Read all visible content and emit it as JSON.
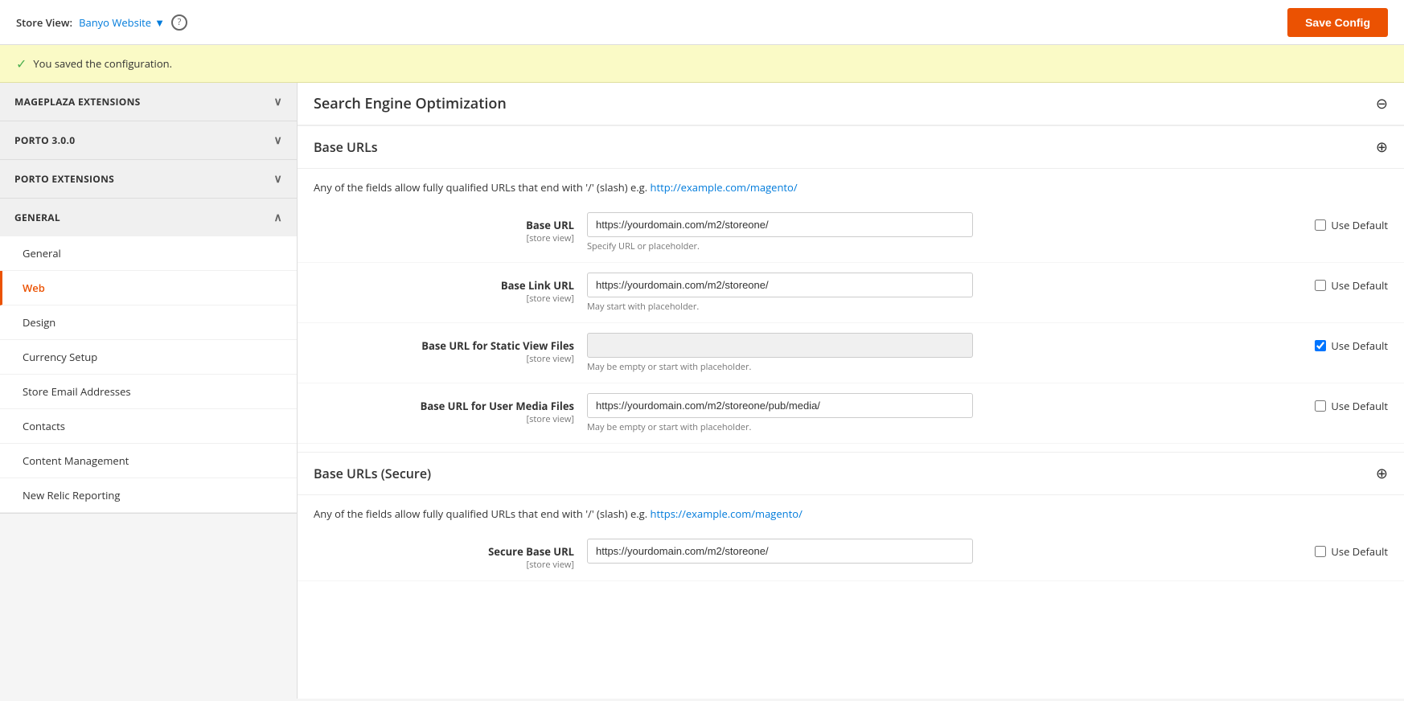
{
  "header": {
    "store_view_label": "Store View:",
    "store_view_name": "Banyo Website",
    "save_button_label": "Save Config"
  },
  "success_message": "You saved the configuration.",
  "sidebar": {
    "sections": [
      {
        "id": "mageplaza-extensions",
        "label": "MAGEPLAZA EXTENSIONS",
        "expanded": false,
        "items": []
      },
      {
        "id": "porto-300",
        "label": "PORTO 3.0.0",
        "expanded": false,
        "items": []
      },
      {
        "id": "porto-extensions",
        "label": "PORTO EXTENSIONS",
        "expanded": false,
        "items": []
      },
      {
        "id": "general",
        "label": "GENERAL",
        "expanded": true,
        "items": [
          {
            "id": "general",
            "label": "General",
            "active": false
          },
          {
            "id": "web",
            "label": "Web",
            "active": true
          },
          {
            "id": "design",
            "label": "Design",
            "active": false
          },
          {
            "id": "currency-setup",
            "label": "Currency Setup",
            "active": false
          },
          {
            "id": "store-email-addresses",
            "label": "Store Email Addresses",
            "active": false
          },
          {
            "id": "contacts",
            "label": "Contacts",
            "active": false
          },
          {
            "id": "content-management",
            "label": "Content Management",
            "active": false
          },
          {
            "id": "new-relic-reporting",
            "label": "New Relic Reporting",
            "active": false
          }
        ]
      }
    ]
  },
  "main": {
    "sections": [
      {
        "id": "seo",
        "title": "Search Engine Optimization",
        "collapsed": true
      },
      {
        "id": "base-urls",
        "title": "Base URLs",
        "collapsed": false,
        "description": "Any of the fields allow fully qualified URLs that end with '/' (slash) e.g. http://example.com/magento/",
        "description_link": "http://example.com/magento/",
        "fields": [
          {
            "id": "base-url",
            "label": "Base URL",
            "sublabel": "[store view]",
            "value": "https://yourdomain.com/m2/storeone/",
            "hint": "Specify URL or placeholder.",
            "use_default": false,
            "disabled": false
          },
          {
            "id": "base-link-url",
            "label": "Base Link URL",
            "sublabel": "[store view]",
            "value": "https://yourdomain.com/m2/storeone/",
            "hint": "May start with placeholder.",
            "use_default": false,
            "disabled": false
          },
          {
            "id": "base-url-static",
            "label": "Base URL for Static View Files",
            "sublabel": "[store view]",
            "value": "",
            "hint": "May be empty or start with placeholder.",
            "use_default": true,
            "disabled": true
          },
          {
            "id": "base-url-media",
            "label": "Base URL for User Media Files",
            "sublabel": "[store view]",
            "value": "https://yourdomain.com/m2/storeone/pub/media/",
            "hint": "May be empty or start with placeholder.",
            "use_default": false,
            "disabled": false
          }
        ]
      },
      {
        "id": "base-urls-secure",
        "title": "Base URLs (Secure)",
        "collapsed": false,
        "description": "Any of the fields allow fully qualified URLs that end with '/' (slash) e.g. https://example.com/magento/",
        "description_link": "https://example.com/magento/",
        "fields": [
          {
            "id": "secure-base-url",
            "label": "Secure Base URL",
            "sublabel": "[store view]",
            "value": "https://yourdomain.com/m2/storeone/",
            "hint": "",
            "use_default": false,
            "disabled": false
          }
        ]
      }
    ],
    "use_default_label": "Use Default"
  }
}
